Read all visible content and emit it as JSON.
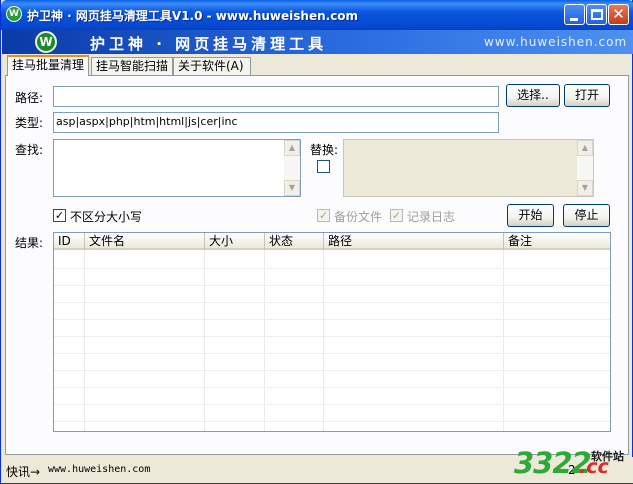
{
  "window": {
    "title": "护卫神 · 网页挂马清理工具V1.0 - www.huweishen.com",
    "buttons": {
      "minimize": "minimize",
      "maximize": "maximize",
      "close": "close"
    }
  },
  "banner": {
    "logo_letter": "W",
    "title": "护卫神 · 网页挂马清理工具",
    "url": "www.huweishen.com"
  },
  "tabs": [
    {
      "label": "挂马批量清理",
      "active": true
    },
    {
      "label": "挂马智能扫描",
      "active": false
    },
    {
      "label": "关于软件(A)",
      "active": false
    }
  ],
  "form": {
    "path_label": "路径:",
    "path_value": "",
    "browse_button": "选择..",
    "open_button": "打开",
    "type_label": "类型:",
    "type_value": "asp|aspx|php|htm|html|js|cer|inc",
    "find_label": "查找:",
    "find_value": "",
    "replace_label": "替换:",
    "replace_checked": false,
    "replace_value": "",
    "case_insensitive_label": "不区分大小写",
    "case_insensitive_checked": true,
    "backup_label": "备份文件",
    "backup_checked": true,
    "log_label": "记录日志",
    "log_checked": true,
    "start_button": "开始",
    "stop_button": "停止"
  },
  "results": {
    "label": "结果:",
    "columns": [
      "ID",
      "文件名",
      "大小",
      "状态",
      "路径",
      "备注"
    ],
    "rows": []
  },
  "statusbar": {
    "shortcut_label": "快讯→",
    "url": "www.huweishen.com",
    "partial_text": "2"
  },
  "watermark": {
    "number": "3322",
    "suffix": ".cc",
    "site_label": "软件站"
  },
  "colors": {
    "titlebar": "#0a57de",
    "accent_tab": "#e68b2c",
    "watermark_green": "#2ea836",
    "watermark_red": "#e2252b"
  }
}
